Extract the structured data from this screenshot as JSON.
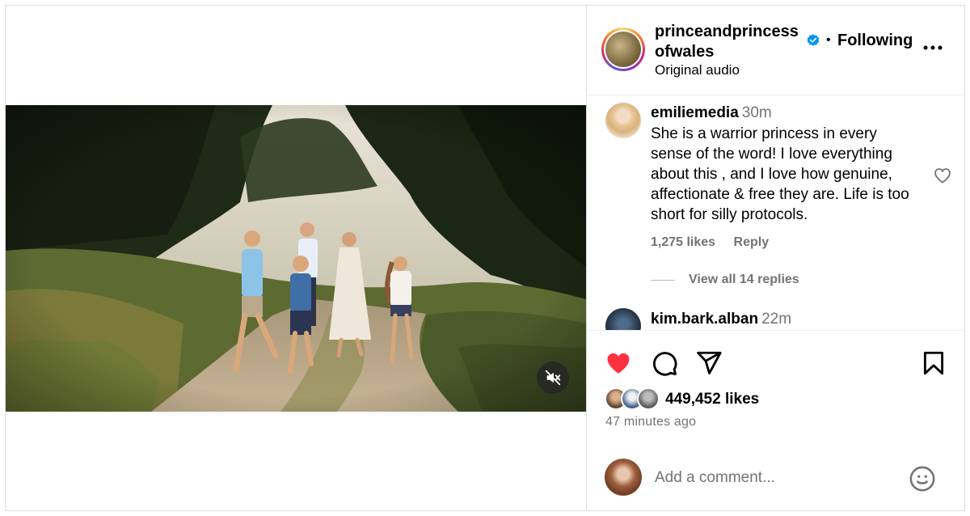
{
  "post": {
    "username": "princeandprincessofwales",
    "username_line1": "princeandprincess",
    "username_line2": "ofwales",
    "separator": "•",
    "follow_status": "Following",
    "audio": "Original audio",
    "more_label": "..."
  },
  "comments": [
    {
      "username": "emiliemedia",
      "time": "30m",
      "text": "She is a warrior princess in every sense of the word! I love everything about this , and I love how genuine, affectionate & free they are. Life is too short for silly protocols.",
      "likes": "1,275 likes",
      "reply_label": "Reply",
      "view_replies": "View all 14 replies"
    },
    {
      "username": "kim.bark.alban",
      "time": "22m"
    }
  ],
  "stats": {
    "likes": "449,452 likes",
    "posted": "47 minutes ago"
  },
  "add_comment": {
    "placeholder": "Add a comment..."
  },
  "icons": {
    "like": "heart-filled-icon",
    "comment": "comment-icon",
    "share": "paper-plane-icon",
    "save": "bookmark-icon",
    "mute": "speaker-muted-icon",
    "verified": "verified-badge-icon",
    "emoji": "emoji-icon",
    "more": "more-options-icon"
  },
  "colors": {
    "like_red": "#ff3040",
    "verified_blue": "#0095f6",
    "secondary_text": "#737373",
    "border": "#dbdbdb"
  }
}
